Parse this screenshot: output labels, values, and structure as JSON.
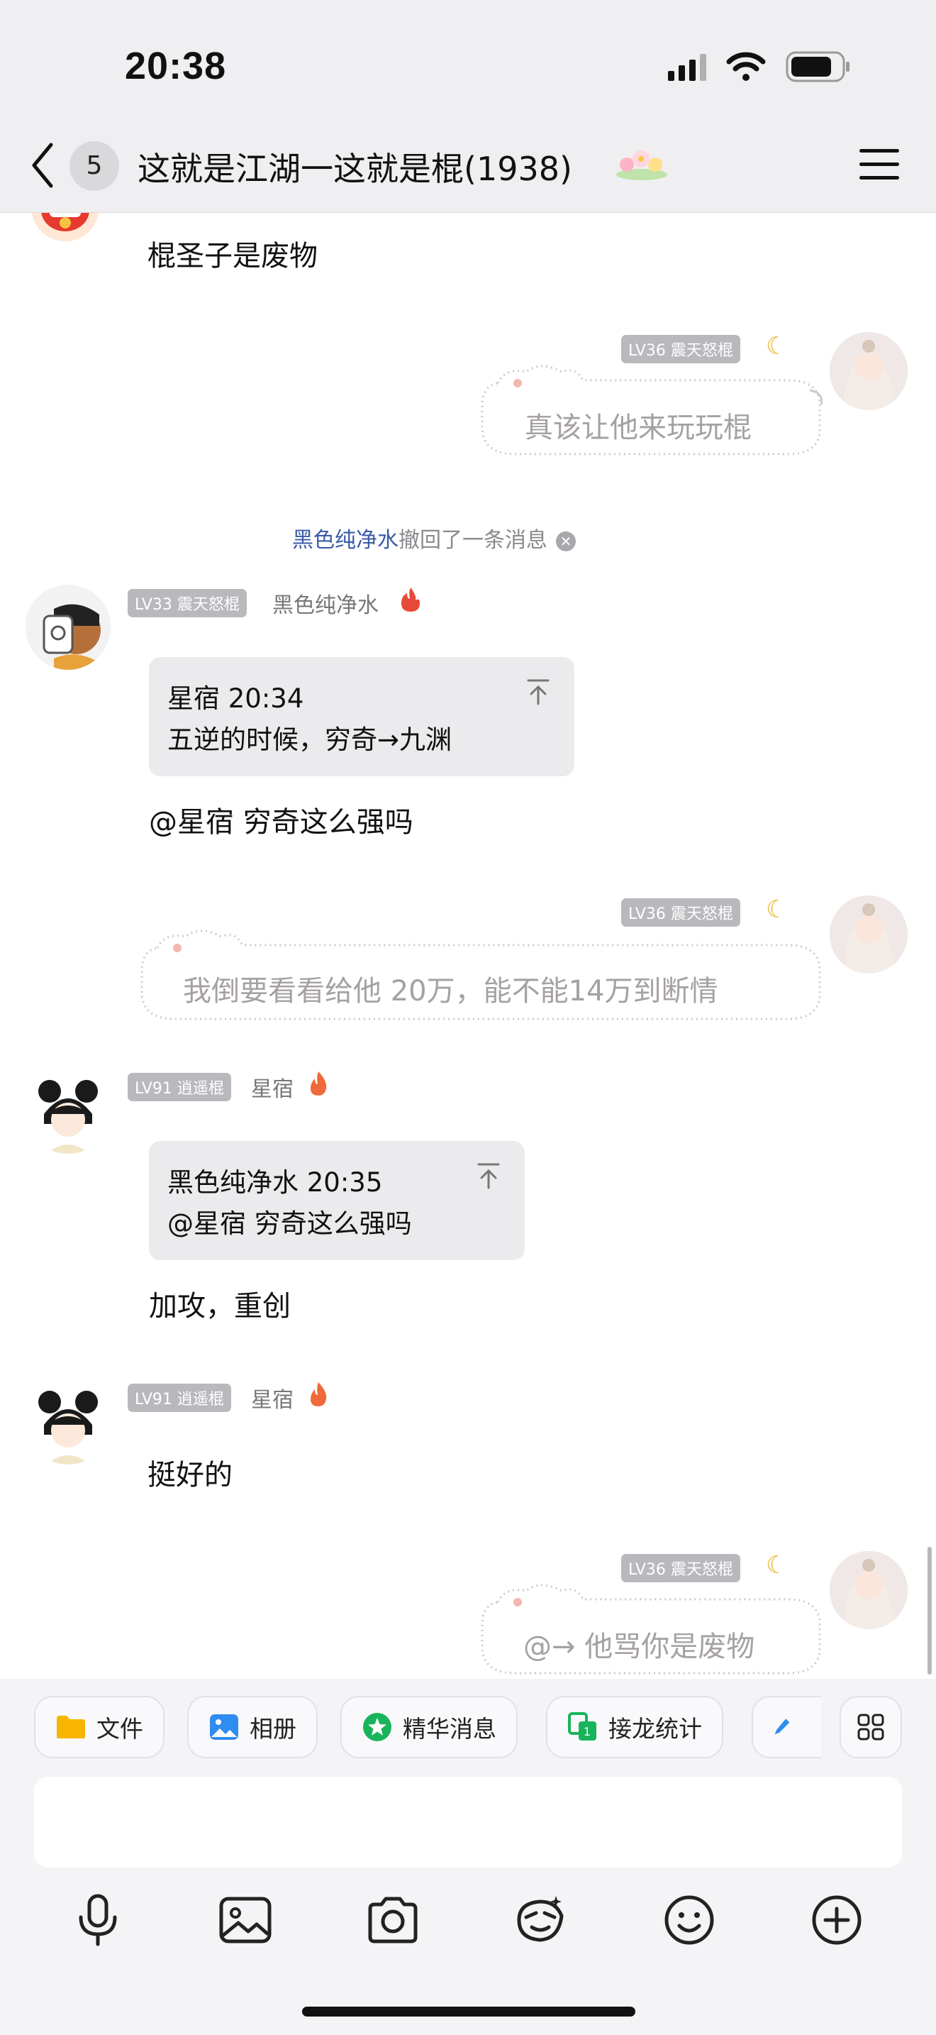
{
  "status": {
    "time": "20:38"
  },
  "header": {
    "unread": "5",
    "title": "这就是江湖一这就是棍(1938)"
  },
  "messages": {
    "m1": {
      "text": "棍圣子是废物"
    },
    "m2": {
      "level": "LV36 震天怒棍",
      "text": "真该让他来玩玩棍"
    },
    "recall": {
      "who": "黑色纯净水",
      "text": "撤回了一条消息"
    },
    "m3": {
      "level": "LV33 震天怒棍",
      "nick": "黑色纯净水",
      "quote_head": "星宿 20:34",
      "quote_body": "五逆的时候，穷奇→九渊",
      "text": "@星宿 穷奇这么强吗"
    },
    "m4": {
      "level": "LV36 震天怒棍",
      "text": "我倒要看看给他 20万，能不能14万到断情"
    },
    "m5": {
      "level": "LV91 逍遥棍",
      "nick": "星宿",
      "quote_head": "黑色纯净水 20:35",
      "quote_body": "@星宿 穷奇这么强吗",
      "text": "加攻，重创"
    },
    "m6": {
      "level": "LV91 逍遥棍",
      "nick": "星宿",
      "text": "挺好的"
    },
    "m7": {
      "level": "LV36 震天怒棍",
      "text": "@→ 他骂你是废物"
    }
  },
  "shortcuts": [
    {
      "label": "文件",
      "icon": "folder-icon"
    },
    {
      "label": "相册",
      "icon": "album-icon"
    },
    {
      "label": "精华消息",
      "icon": "star-badge-icon"
    },
    {
      "label": "接龙统计",
      "icon": "relay-icon"
    },
    {
      "label": "",
      "icon": "pencil-icon"
    }
  ],
  "toolbar_icons": [
    "microphone-icon",
    "image-icon",
    "camera-icon",
    "sticker-icon",
    "emoji-icon",
    "plus-icon"
  ],
  "colors": {
    "accent_blue": "#3b5aa8",
    "badge_gray": "#b9b9bd",
    "quote_bg": "#ebebed"
  }
}
